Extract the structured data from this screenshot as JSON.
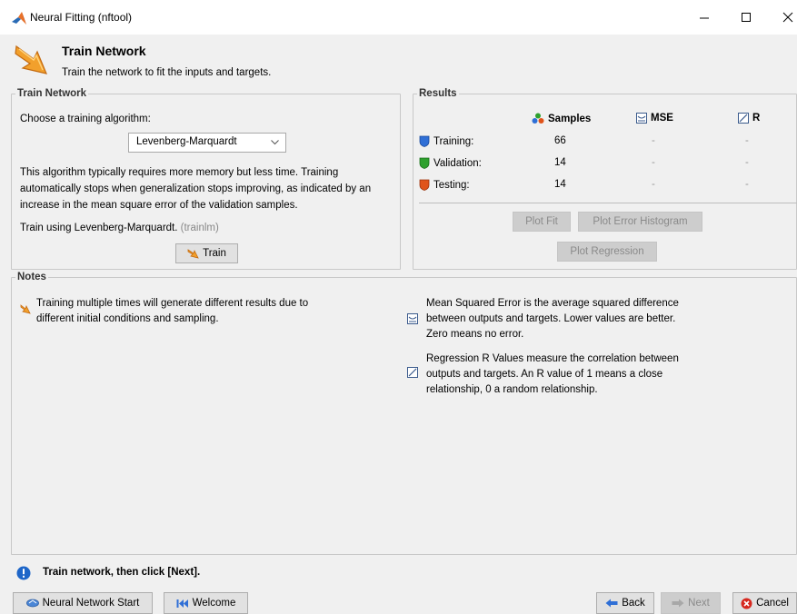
{
  "window": {
    "title": "Neural Fitting (nftool)",
    "icon": "matlab-logo"
  },
  "header": {
    "title": "Train Network",
    "subtitle": "Train the network to fit the inputs and targets.",
    "icon": "train-arrow-icon"
  },
  "train_panel": {
    "legend": "Train Network",
    "choose_label": "Choose a training algorithm:",
    "algorithm_selected": "Levenberg-Marquardt",
    "description": "This algorithm typically requires more memory but less time. Training automatically stops when generalization stops improving, as indicated by an increase in the mean square error of the validation samples.",
    "train_using": "Train using Levenberg-Marquardt.",
    "train_using_code": "(trainlm)",
    "train_button": "Train"
  },
  "results_panel": {
    "legend": "Results",
    "columns": {
      "samples": "Samples",
      "mse": "MSE",
      "r": "R"
    },
    "rows": [
      {
        "label": "Training:",
        "samples": "66",
        "mse": "-",
        "r": "-",
        "color": "#2f6fd6"
      },
      {
        "label": "Validation:",
        "samples": "14",
        "mse": "-",
        "r": "-",
        "color": "#2ea02e"
      },
      {
        "label": "Testing:",
        "samples": "14",
        "mse": "-",
        "r": "-",
        "color": "#e0531a"
      }
    ],
    "buttons": {
      "plot_fit": "Plot Fit",
      "plot_error_histogram": "Plot Error Histogram",
      "plot_regression": "Plot Regression"
    }
  },
  "notes_panel": {
    "legend": "Notes",
    "note_train": "Training multiple times will generate different results due to different initial conditions and sampling.",
    "note_mse": "Mean Squared Error is the average squared difference between outputs and targets. Lower values are better. Zero means no error.",
    "note_r": "Regression R Values measure the correlation between outputs and targets. An R value of 1 means a close relationship, 0 a random relationship."
  },
  "status": {
    "message": "Train network, then click [Next]."
  },
  "footer": {
    "nn_start": "Neural Network Start",
    "welcome": "Welcome",
    "back": "Back",
    "next": "Next",
    "cancel": "Cancel"
  },
  "colors": {
    "accent_orange": "#f08a1c",
    "info_blue": "#1e66c8",
    "cancel_red": "#d6281f"
  }
}
